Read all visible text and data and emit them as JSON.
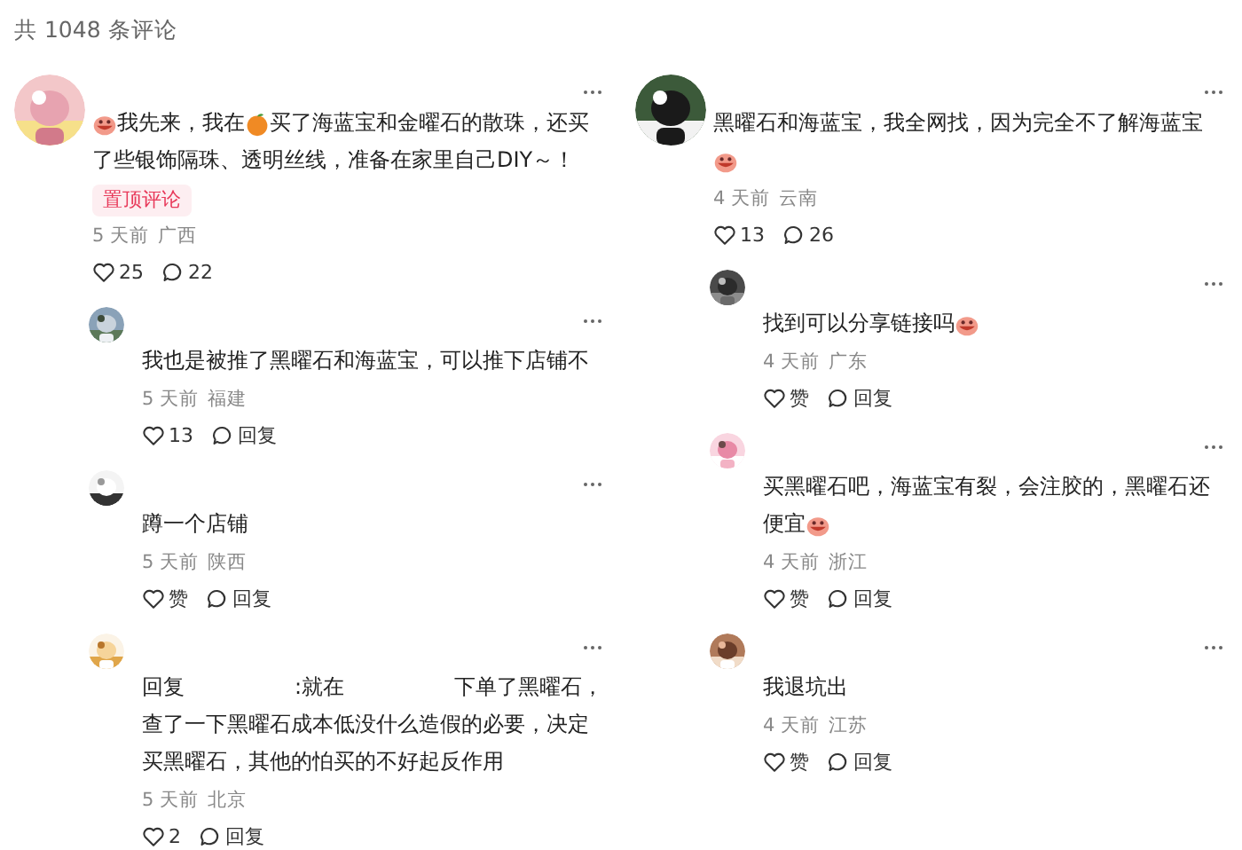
{
  "header": {
    "count_text": "共 1048 条评论"
  },
  "columns": [
    {
      "comments": [
        {
          "avatar": {
            "kind": "picture"
          },
          "lines": [
            [
              {
                "kind": "sticker"
              },
              {
                "kind": "text",
                "text": "我先来，我在"
              },
              {
                "kind": "fruit"
              },
              {
                "kind": "text",
                "text": "买了海蓝宝和金曜石的散珠，还买"
              }
            ],
            [
              {
                "kind": "text",
                "text": "了些银饰隔珠、透明丝线，准备在家里自己DIY～！"
              }
            ]
          ],
          "tag": "置顶评论",
          "time": "5 天前",
          "location": "广西",
          "like": "25",
          "reply": "22",
          "replies": [
            {
              "avatar": {
                "kind": "picture"
              },
              "lines": [
                [
                  {
                    "kind": "text",
                    "text": "我也是被推了黑曜石和海蓝宝，可以推下店铺不"
                  }
                ]
              ],
              "time": "5 天前",
              "location": "福建",
              "like": "13",
              "reply": "回复"
            },
            {
              "avatar": {
                "kind": "picture"
              },
              "lines": [
                [
                  {
                    "kind": "text",
                    "text": "蹲一个店铺"
                  }
                ]
              ],
              "time": "5 天前",
              "location": "陕西",
              "like": "赞",
              "reply": "回复"
            },
            {
              "avatar": {
                "kind": "picture"
              },
              "lines": [
                [
                  {
                    "kind": "text",
                    "text": "回复"
                  },
                  {
                    "kind": "gap"
                  },
                  {
                    "kind": "text",
                    "text": ":就在"
                  },
                  {
                    "kind": "gap"
                  },
                  {
                    "kind": "text",
                    "text": "下单了黑曜石，"
                  }
                ],
                [
                  {
                    "kind": "text",
                    "text": "查了一下黑曜石成本低没什么造假的必要，决定"
                  }
                ],
                [
                  {
                    "kind": "text",
                    "text": "买黑曜石，其他的怕买的不好起反作用"
                  }
                ]
              ],
              "time": "5 天前",
              "location": "北京",
              "like": "2",
              "reply": "回复"
            }
          ]
        }
      ]
    },
    {
      "comments": [
        {
          "avatar": {
            "kind": "picture"
          },
          "lines": [
            [
              {
                "kind": "text",
                "text": "黑曜石和海蓝宝，我全网找，因为完全不了解海蓝宝"
              }
            ],
            [
              {
                "kind": "sticker"
              }
            ]
          ],
          "time": "4 天前",
          "location": "云南",
          "like": "13",
          "reply": "26",
          "replies": [
            {
              "avatar": {
                "kind": "picture"
              },
              "lines": [
                [
                  {
                    "kind": "text",
                    "text": "找到可以分享链接吗"
                  },
                  {
                    "kind": "sticker"
                  }
                ]
              ],
              "time": "4 天前",
              "location": "广东",
              "like": "赞",
              "reply": "回复"
            },
            {
              "avatar": {
                "kind": "picture"
              },
              "lines": [
                [
                  {
                    "kind": "text",
                    "text": "买黑曜石吧，海蓝宝有裂，会注胶的，黑曜石还"
                  }
                ],
                [
                  {
                    "kind": "text",
                    "text": "便宜"
                  },
                  {
                    "kind": "sticker"
                  }
                ]
              ],
              "time": "4 天前",
              "location": "浙江",
              "like": "赞",
              "reply": "回复"
            },
            {
              "avatar": {
                "kind": "picture"
              },
              "lines": [
                [
                  {
                    "kind": "text",
                    "text": "我退坑出"
                  }
                ]
              ],
              "time": "4 天前",
              "location": "江苏",
              "like": "赞",
              "reply": "回复"
            }
          ]
        }
      ]
    }
  ]
}
